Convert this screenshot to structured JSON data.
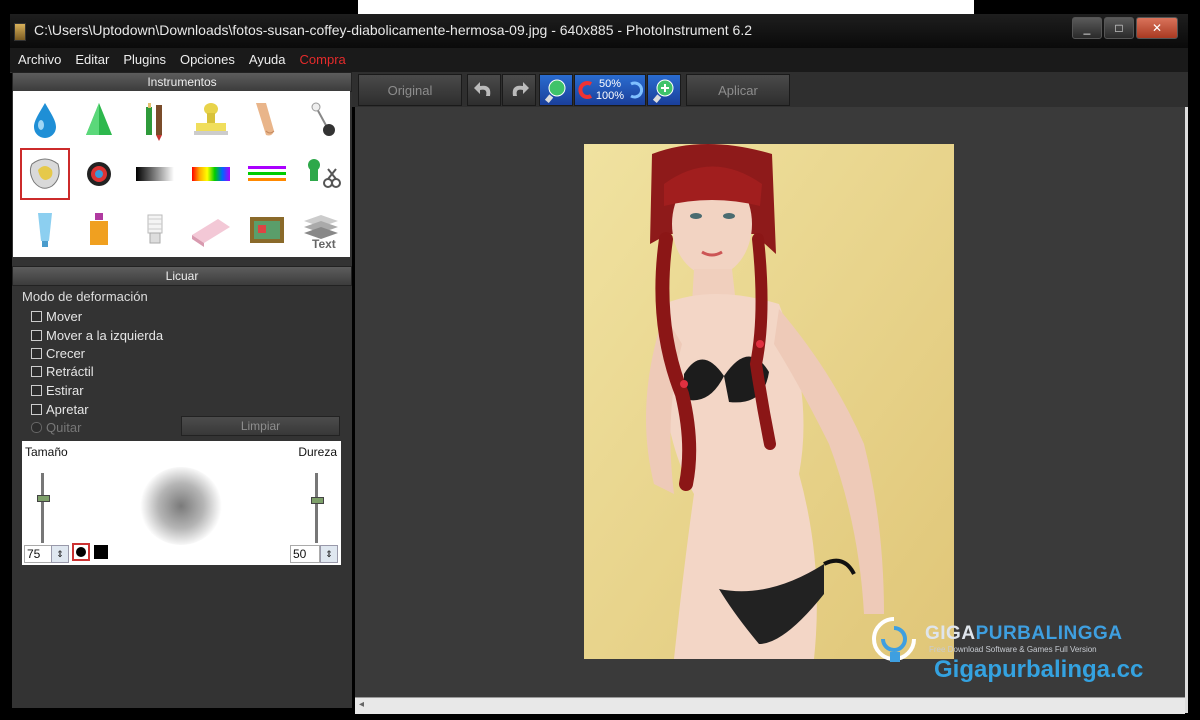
{
  "window": {
    "title": "C:\\Users\\Uptodown\\Downloads\\fotos-susan-coffey-diabolicamente-hermosa-09.jpg - 640x885 - PhotoInstrument 6.2",
    "minimize": "_",
    "maximize": "□",
    "close": "✕"
  },
  "menu": {
    "items": [
      "Archivo",
      "Editar",
      "Plugins",
      "Opciones",
      "Ayuda",
      "Compra"
    ]
  },
  "panel": {
    "instrumentos_title": "Instrumentos",
    "licuar_title": "Licuar",
    "mode_label": "Modo de deformación",
    "options": [
      "Mover",
      "Mover a la izquierda",
      "Crecer",
      "Retráctil",
      "Estirar",
      "Apretar"
    ],
    "quitar": "Quitar",
    "limpiar": "Limpiar",
    "size_label": "Tamaño",
    "hardness_label": "Dureza",
    "size_value": "75",
    "hardness_value": "50"
  },
  "toolbar": {
    "original": "Original",
    "zoom_top": "50%",
    "zoom_bottom": "100%",
    "aplicar": "Aplicar"
  },
  "tools": {
    "icons": [
      "water-drop",
      "cone",
      "pencils",
      "stamp",
      "finger",
      "pin",
      "liquify",
      "red-eye",
      "gradient",
      "rainbow",
      "color-lines",
      "clone-scissors",
      "tube",
      "bottle",
      "bulb",
      "eraser",
      "film-box",
      "text-layers"
    ],
    "text_tool_label": "Text"
  },
  "watermark": {
    "brand_part1": "GIGA",
    "brand_part2": "PURBALINGGA",
    "tagline": "Free Download Software & Games Full Version",
    "url": "Gigapurbalinga.cc"
  },
  "colors": {
    "menu_highlight": "#e42b2b",
    "selection": "#cc2b2b",
    "brand_blue": "#34a2e0"
  }
}
